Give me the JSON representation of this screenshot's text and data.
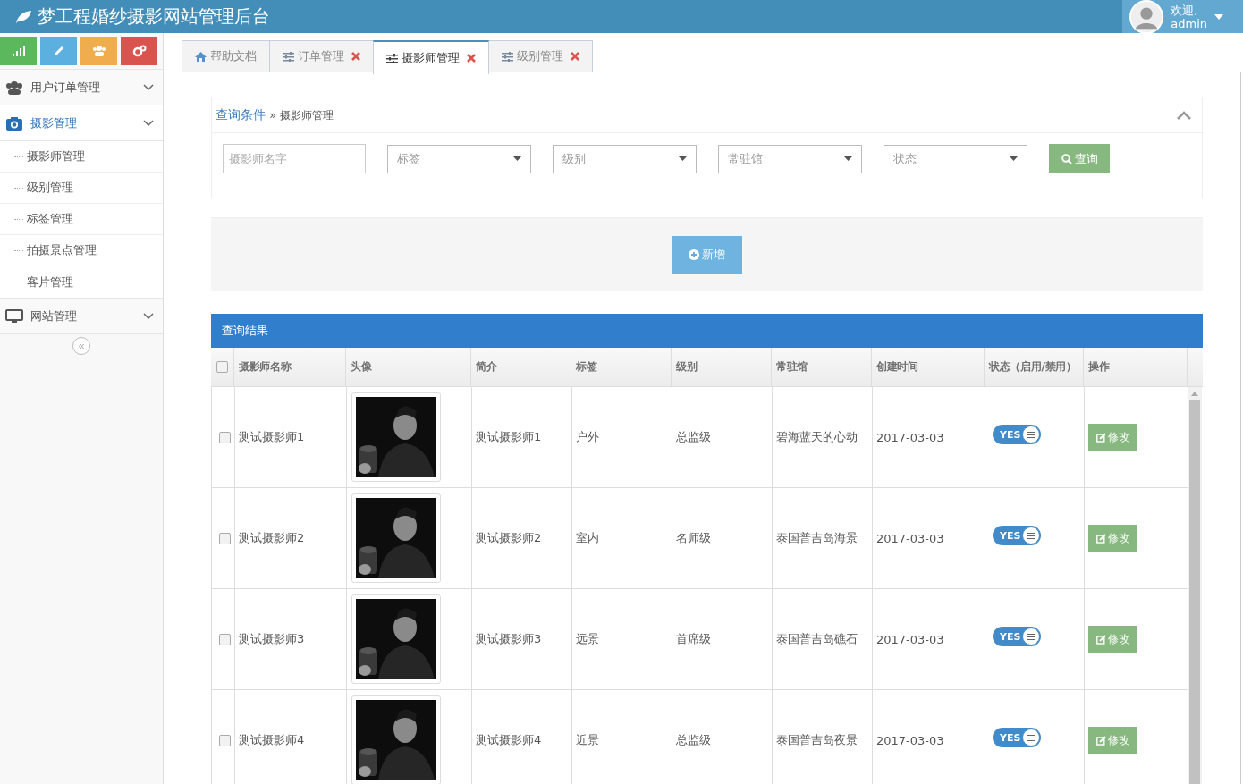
{
  "header": {
    "title": "梦工程婚纱摄影网站管理后台",
    "user": {
      "greeting": "欢迎,",
      "name": "admin"
    }
  },
  "sidebar": {
    "shortcuts": [
      {
        "kind": "chart",
        "color": "#5cb85c"
      },
      {
        "kind": "pencil",
        "color": "#5bb0e0"
      },
      {
        "kind": "users",
        "color": "#f0ad4e"
      },
      {
        "kind": "gears",
        "color": "#d9534f"
      }
    ],
    "items": [
      {
        "label": "用户订单管理",
        "kind": "users",
        "selected": false
      },
      {
        "label": "摄影管理",
        "kind": "camera",
        "expanded": true,
        "selected": true,
        "children": [
          {
            "label": "摄影师管理"
          },
          {
            "label": "级别管理"
          },
          {
            "label": "标签管理"
          },
          {
            "label": "拍摄景点管理"
          },
          {
            "label": "客片管理"
          }
        ]
      },
      {
        "label": "网站管理",
        "kind": "monitor",
        "selected": false
      }
    ],
    "collapse_label": "«"
  },
  "tabs": [
    {
      "label": "帮助文档",
      "kind": "home",
      "closable": false,
      "selected": false
    },
    {
      "label": "订单管理",
      "kind": "sliders",
      "closable": true,
      "selected": false
    },
    {
      "label": "摄影师管理",
      "kind": "sliders",
      "closable": true,
      "selected": true
    },
    {
      "label": "级别管理",
      "kind": "sliders",
      "closable": true,
      "selected": false
    }
  ],
  "query": {
    "title": "查询条件",
    "separator": "»",
    "breadcrumb": "摄影师管理",
    "name_field": {
      "placeholder": "摄影师名字"
    },
    "selects": [
      {
        "value": "标签"
      },
      {
        "value": "级别"
      },
      {
        "value": "常驻馆"
      },
      {
        "value": "状态"
      }
    ],
    "search_button": "查询"
  },
  "add_button": "新增",
  "results": {
    "title": "查询结果",
    "select_all_checked": false,
    "columns": [
      "摄影师名称",
      "头像",
      "简介",
      "标签",
      "级别",
      "常驻馆",
      "创建时间",
      "状态（启用/禁用）",
      "操作"
    ],
    "rows": [
      {
        "name": "测试摄影师1",
        "intro": "测试摄影师1",
        "tag": "户外",
        "level": "总监级",
        "hall": "碧海蓝天的心动",
        "created": "2017-03-03",
        "status": {
          "on": true,
          "label": "YES"
        },
        "action": "修改",
        "checked": false
      },
      {
        "name": "测试摄影师2",
        "intro": "测试摄影师2",
        "tag": "室内",
        "level": "名师级",
        "hall": "泰国普吉岛海景",
        "created": "2017-03-03",
        "status": {
          "on": true,
          "label": "YES"
        },
        "action": "修改",
        "checked": false
      },
      {
        "name": "测试摄影师3",
        "intro": "测试摄影师3",
        "tag": "远景",
        "level": "首席级",
        "hall": "泰国普吉岛礁石",
        "created": "2017-03-03",
        "status": {
          "on": true,
          "label": "YES"
        },
        "action": "修改",
        "checked": false
      },
      {
        "name": "测试摄影师4",
        "intro": "测试摄影师4",
        "tag": "近景",
        "level": "总监级",
        "hall": "泰国普吉岛夜景",
        "created": "2017-03-03",
        "status": {
          "on": true,
          "label": "YES"
        },
        "action": "修改",
        "checked": false
      }
    ]
  }
}
